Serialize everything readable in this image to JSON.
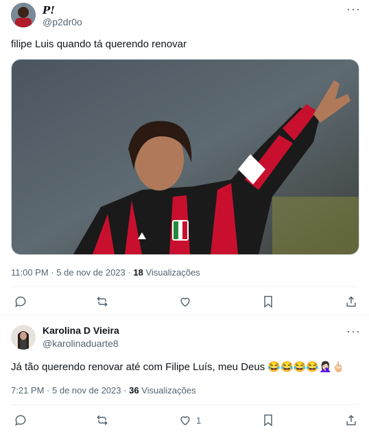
{
  "tweet": {
    "display_name": "P!",
    "handle": "@p2dr0o",
    "text": "filipe Luis quando tá querendo  renovar",
    "time": "11:00 PM",
    "date": "5 de nov de 2023",
    "views_count": "18",
    "views_label": "Visualizações"
  },
  "reply": {
    "display_name": "Karolina D Vieira",
    "handle": "@karolinaduarte8",
    "text": "Já tão querendo renovar até com Filipe Luís, meu Deus 😂😂😂😂🤦🏻‍♀️🖕🏻",
    "time": "7:21 PM",
    "date": "5 de nov de 2023",
    "views_count": "36",
    "views_label": "Visualizações",
    "likes": "1"
  },
  "separator": "·",
  "more_glyph": "···",
  "colors": {
    "text": "#0f1419",
    "muted": "#536471",
    "divider": "#eff3f4",
    "milan_red": "#c8102e"
  },
  "icons": [
    "more-icon",
    "reply-icon",
    "retweet-icon",
    "like-icon",
    "bookmark-icon",
    "share-icon"
  ]
}
